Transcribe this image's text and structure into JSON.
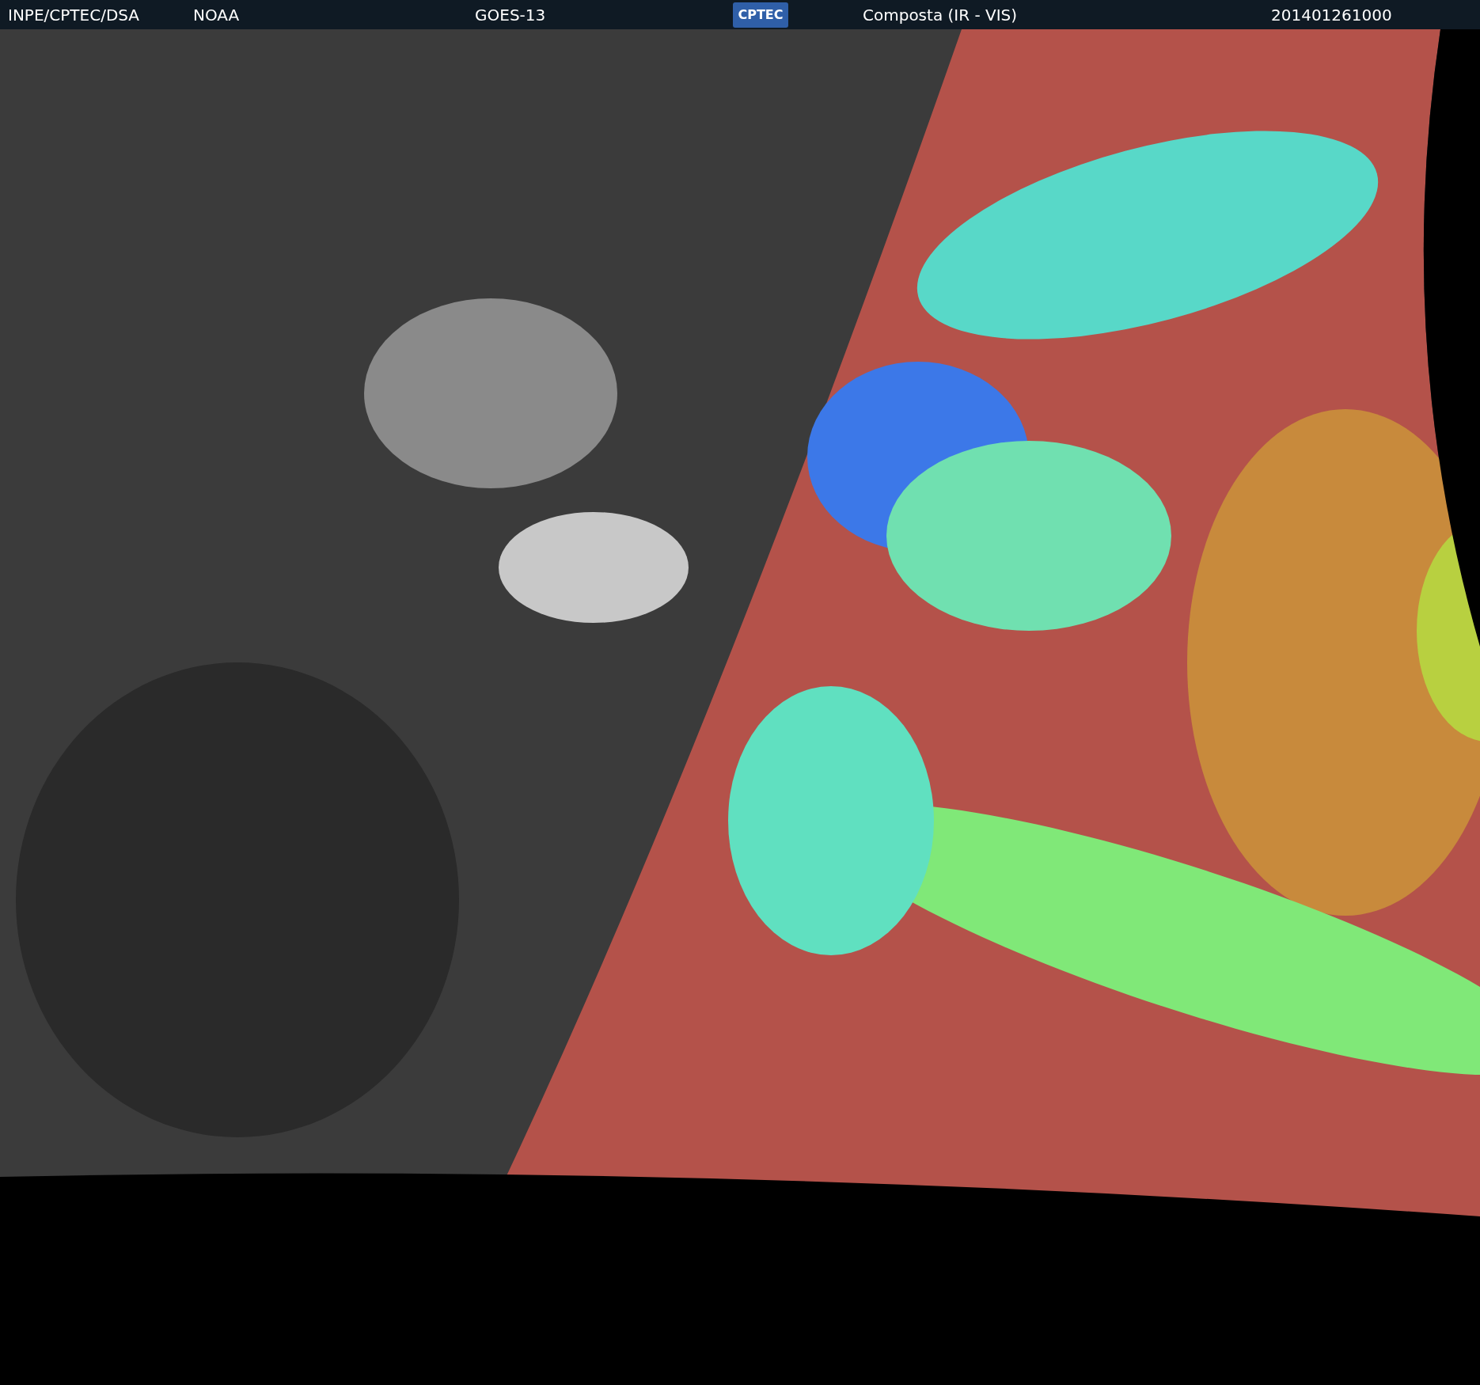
{
  "header": {
    "left_labels": [
      "INPE/CPTEC/DSA",
      "NOAA"
    ],
    "satellite": "GOES-13",
    "logo": "CPTEC",
    "product": "Composta (IR - VIS)",
    "timestamp": "201401261000"
  }
}
